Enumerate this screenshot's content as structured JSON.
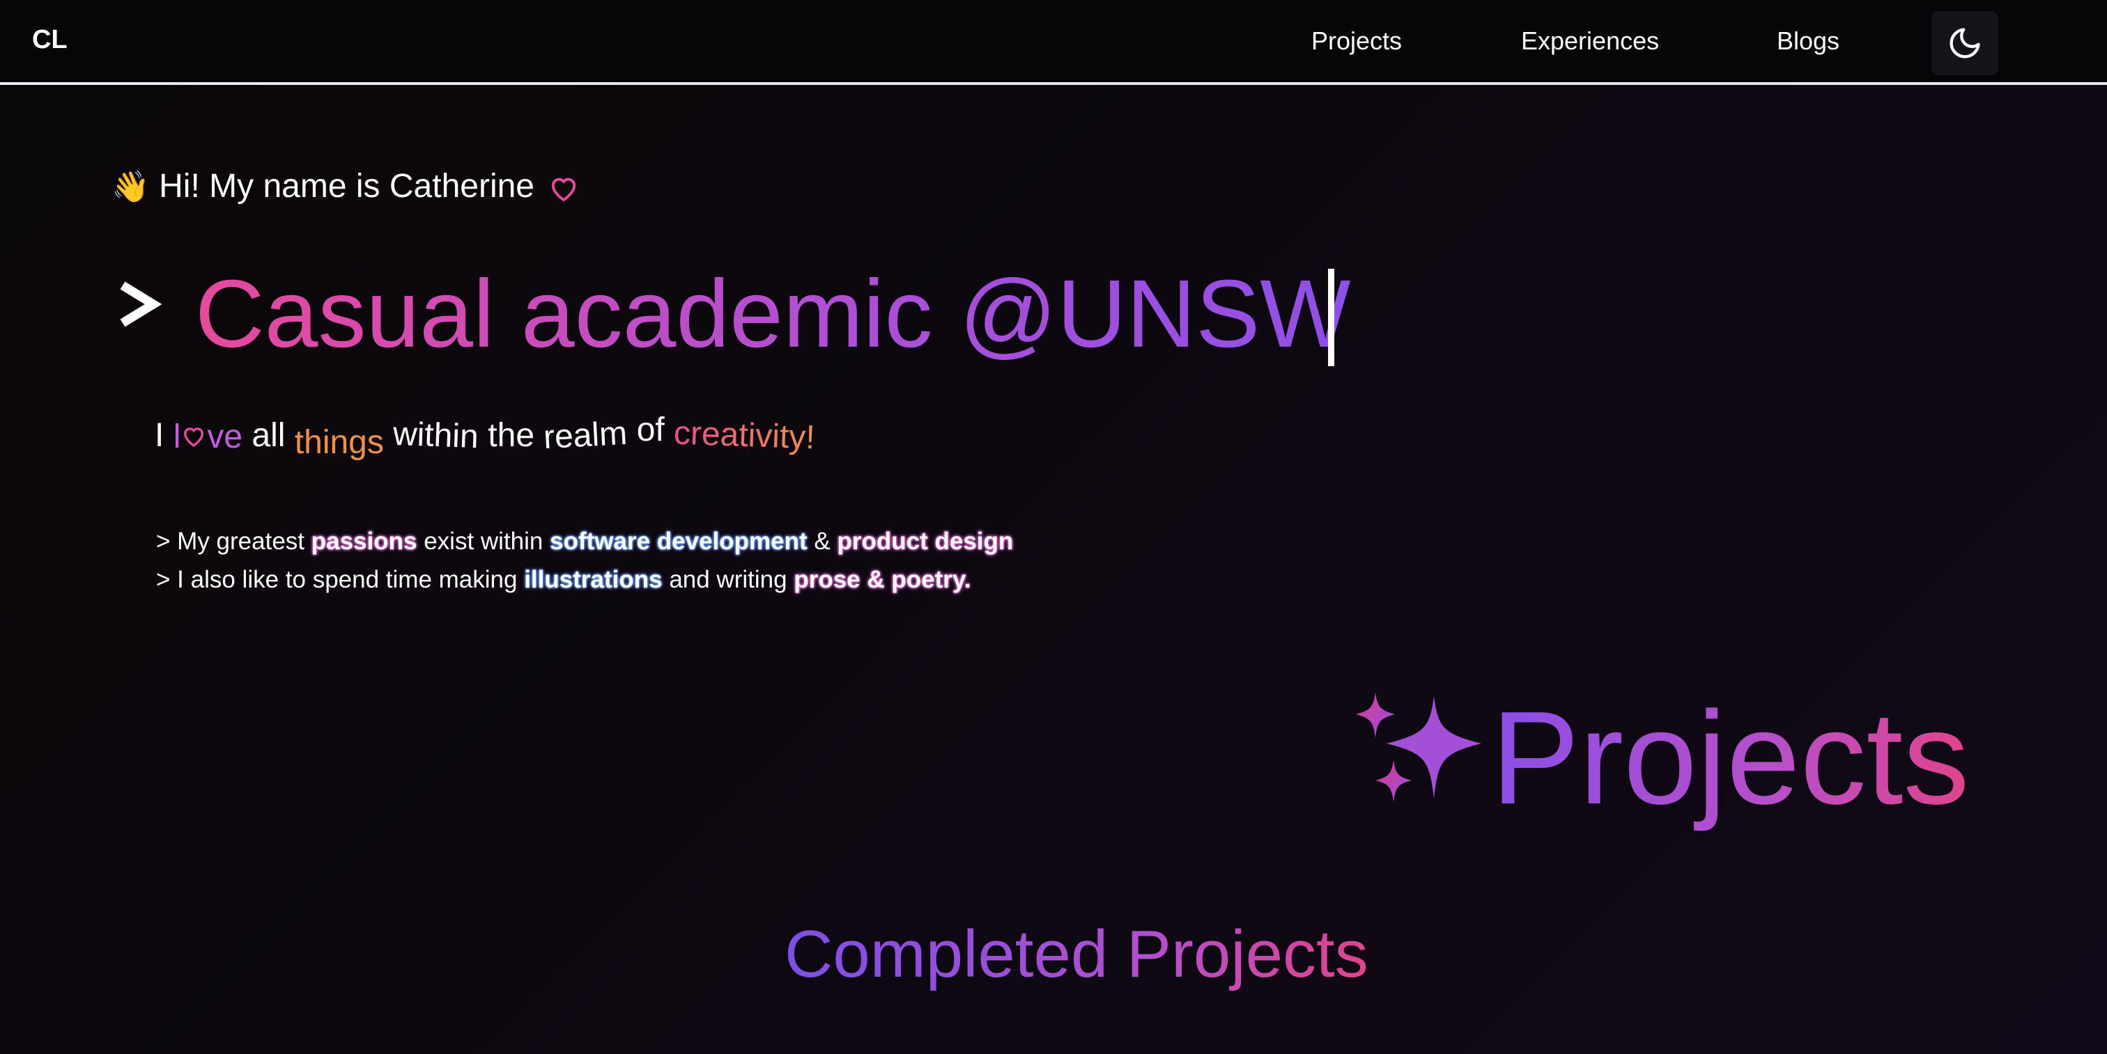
{
  "nav": {
    "logo": "CL",
    "links": [
      "Projects",
      "Experiences",
      "Blogs"
    ],
    "theme_toggle_icon": "moon-icon"
  },
  "hero": {
    "wave_emoji": "👋",
    "greeting": "Hi! My name is Catherine",
    "heart_icon": "heart-icon",
    "headline": "Casual academic @UNSW",
    "tagline": {
      "i": "I",
      "love_l": "l",
      "love_rest": "ve",
      "all": "all",
      "things": "things",
      "within": "within",
      "the": "the",
      "realm": "realm",
      "of": "of",
      "creativity": "creativity!"
    },
    "passions": {
      "line1": {
        "prefix": "> My greatest",
        "passions": "passions",
        "mid": "exist within",
        "software": "software development",
        "amp": "&",
        "product": "product design"
      },
      "line2": {
        "prefix": "> I also like to spend time making",
        "illustrations": "illustrations",
        "mid": "and writing",
        "prose": "prose & poetry."
      }
    }
  },
  "projects": {
    "title": "Projects",
    "subtitle": "Completed Projects"
  },
  "colors": {
    "pink": "#e64a9c",
    "purple": "#8f4fe6",
    "orange": "#f0904a",
    "background": "#0d0810"
  }
}
